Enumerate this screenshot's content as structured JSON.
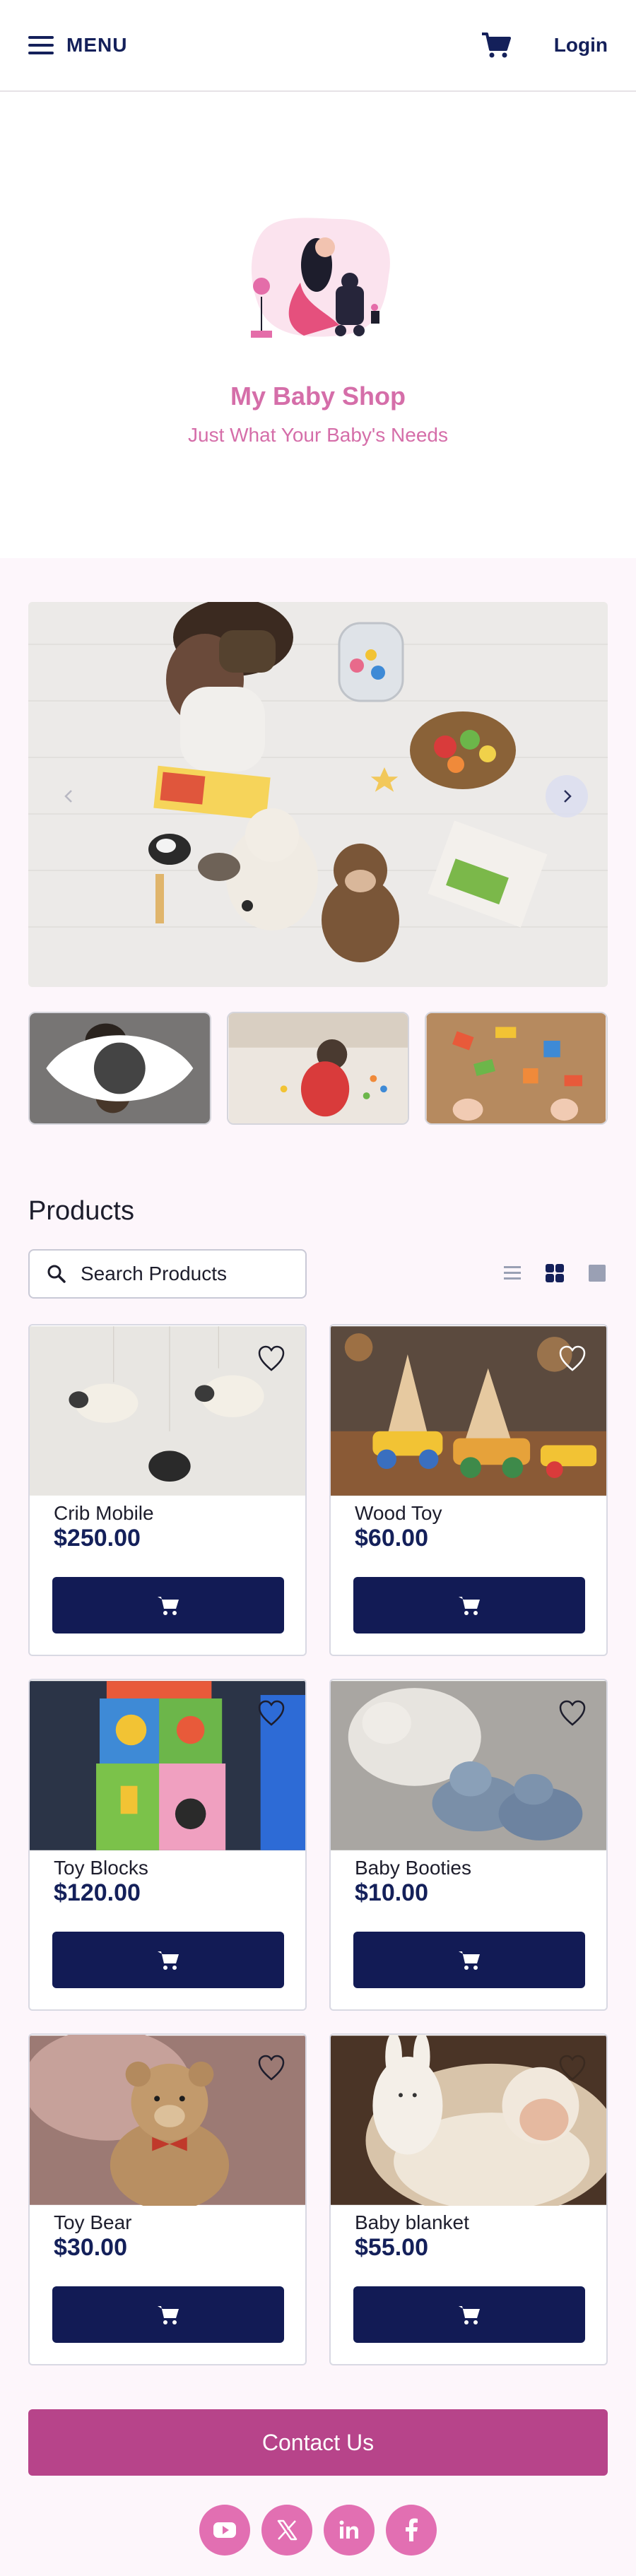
{
  "header": {
    "menu_label": "MENU",
    "login_label": "Login"
  },
  "hero": {
    "title": "My Baby Shop",
    "subtitle": "Just What Your Baby's Needs"
  },
  "products": {
    "section_title": "Products",
    "search_placeholder": "Search Products",
    "items": [
      {
        "name": "Crib Mobile",
        "price": "$250.00"
      },
      {
        "name": "Wood Toy",
        "price": "$60.00"
      },
      {
        "name": "Toy Blocks",
        "price": "$120.00"
      },
      {
        "name": "Baby Booties",
        "price": "$10.00"
      },
      {
        "name": "Toy Bear",
        "price": "$30.00"
      },
      {
        "name": "Baby blanket",
        "price": "$55.00"
      }
    ]
  },
  "footer": {
    "contact_label": "Contact Us",
    "socials": [
      "youtube-icon",
      "x-icon",
      "linkedin-icon",
      "facebook-icon"
    ]
  },
  "colors": {
    "navy": "#121b55",
    "pink": "#d56ea9",
    "contact": "#b7448a",
    "social": "#e26fb2"
  }
}
